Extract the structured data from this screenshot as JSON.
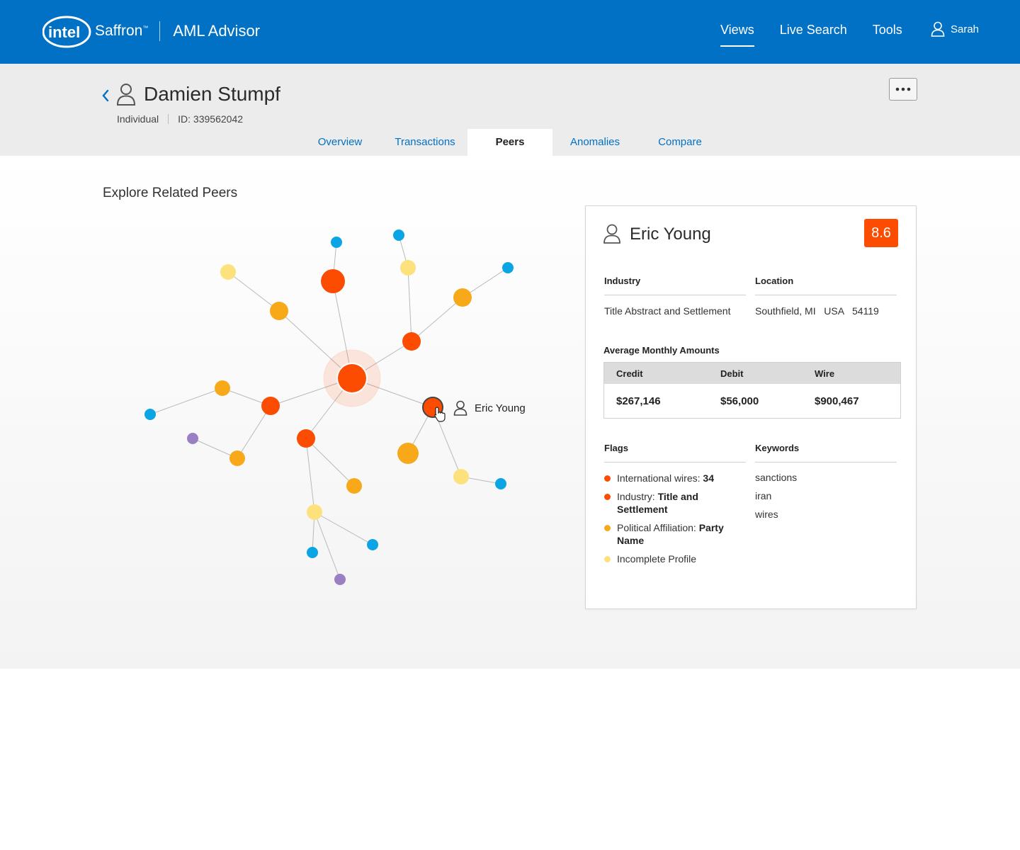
{
  "header": {
    "brand": "Saffron",
    "app_title": "AML Advisor",
    "nav": [
      "Views",
      "Live Search",
      "Tools"
    ],
    "active_nav": "Views",
    "user": "Sarah"
  },
  "entity": {
    "name": "Damien Stumpf",
    "type": "Individual",
    "id": "ID: 339562042",
    "more_label": "•••"
  },
  "tabs": [
    "Overview",
    "Transactions",
    "Peers",
    "Anomalies",
    "Compare"
  ],
  "active_tab": "Peers",
  "main": {
    "section_title": "Explore Related Peers",
    "hover_label": "Eric Young"
  },
  "colors": {
    "brand_blue": "#0071c5",
    "high_risk": "#fc4c02",
    "medium_risk": "#f8a91a",
    "low_risk": "#fde17d",
    "leaf": "#0ba5e6",
    "other": "#9b7fc3"
  },
  "detail": {
    "name": "Eric Young",
    "score": "8.6",
    "industry_label": "Industry",
    "industry_value": "Title Abstract and Settlement",
    "location_label": "Location",
    "location_value": "Southfield, MI   USA   54119",
    "amounts_title": "Average Monthly Amounts",
    "amounts": {
      "headers": [
        "Credit",
        "Debit",
        "Wire"
      ],
      "values": [
        "$267,146",
        "$56,000",
        "$900,467"
      ]
    },
    "flags_label": "Flags",
    "flags": [
      {
        "prefix": "International wires: ",
        "bold": "34",
        "color": "#fc4c02"
      },
      {
        "prefix": "Industry: ",
        "bold": "Title and Settlement",
        "color": "#fc4c02"
      },
      {
        "prefix": "Political Affiliation: ",
        "bold": "Party Name",
        "color": "#f8a91a"
      },
      {
        "prefix": "Incomplete Profile",
        "bold": "",
        "color": "#fde17d"
      }
    ],
    "keywords_label": "Keywords",
    "keywords": [
      "sanctions",
      "iran",
      "wires"
    ]
  }
}
